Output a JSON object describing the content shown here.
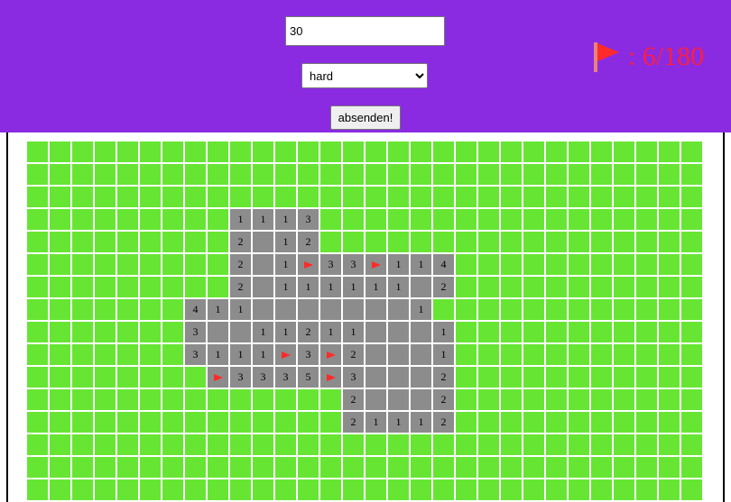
{
  "form": {
    "size_value": "30",
    "difficulty_selected": "hard",
    "submit_label": "absenden!"
  },
  "status": {
    "flag_count": ": 6/180",
    "flag_icon": "flag-icon",
    "flag_color": "#ff2a2a"
  },
  "colors": {
    "header": "#8a2be2",
    "hidden_cell": "#66e633",
    "revealed_cell": "#8c8c8c"
  },
  "board": {
    "columns": 30,
    "visible_rows": 16,
    "rows": [
      "##############################",
      "##############################",
      "##############################",
      "#########1113#################",
      "#########2.12#################",
      "#########2.1F33F114###########",
      "#########2.111111.2###########",
      "#######411.......1############",
      "#######3..11211...1###########",
      "#######3111F3F2...1###########",
      "########F3335F3...2###########",
      "##############2...2###########",
      "##############21112###########",
      "##############################",
      "##############################",
      "##############################"
    ]
  }
}
